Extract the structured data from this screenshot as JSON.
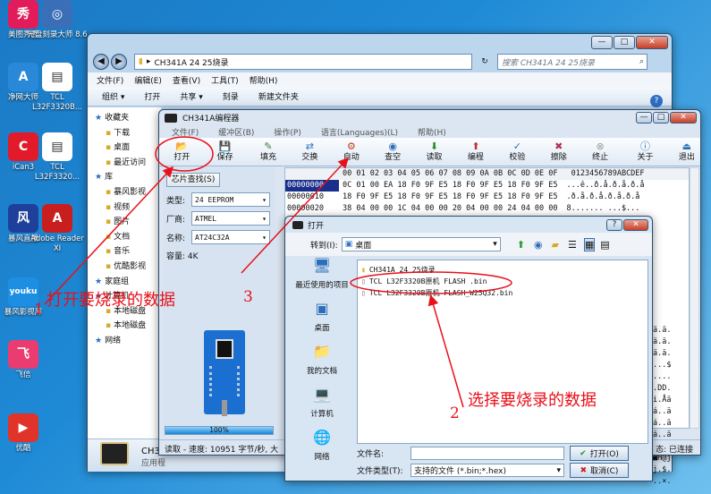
{
  "desktop": {
    "icons": [
      {
        "label": "美图秀秀",
        "icon": "meitu-icon",
        "color": "#e21c5a",
        "glyph": "秀"
      },
      {
        "label": "光盘刻录大师 8.6",
        "icon": "cd-burner-icon",
        "color": "#3a6fb8",
        "glyph": "◎"
      },
      {
        "label": "净网大师",
        "icon": "shield-a-icon",
        "color": "#2a88d8",
        "glyph": "A"
      },
      {
        "label": "TCL L32F3320B...",
        "icon": "document-icon",
        "color": "#ffffff",
        "glyph": "▤"
      },
      {
        "label": "iCan3",
        "icon": "ican-icon",
        "color": "#e11b2a",
        "glyph": "C"
      },
      {
        "label": "TCL L32F3320...",
        "icon": "document-icon",
        "color": "#ffffff",
        "glyph": "▤"
      },
      {
        "label": "暴风直播",
        "icon": "baofeng-icon",
        "color": "#1e3f9a",
        "glyph": "风"
      },
      {
        "label": "Adobe Reader XI",
        "icon": "adobe-reader-icon",
        "color": "#c81e1e",
        "glyph": "A"
      },
      {
        "label": "暴风影视库",
        "icon": "youku-icon",
        "color": "#1d8fe3",
        "glyph": "youku"
      },
      {
        "label": "飞信",
        "icon": "fetion-icon",
        "color": "#ea3c70",
        "glyph": "飞"
      },
      {
        "label": "优酷",
        "icon": "youku-play-icon",
        "color": "#e0342a",
        "glyph": "▶"
      }
    ]
  },
  "explorer": {
    "path": "CH341A 24 25烧录",
    "search_placeholder": "搜索 CH341A 24 25烧录",
    "menu": [
      "文件(F)",
      "编辑(E)",
      "查看(V)",
      "工具(T)",
      "帮助(H)"
    ],
    "toolbar": [
      "组织 ▾",
      "打开",
      "共享 ▾",
      "刻录",
      "新建文件夹"
    ],
    "nav": [
      "收藏夹",
      "下载",
      "桌面",
      "最近访问",
      "库",
      "暴风影视",
      "视频",
      "图片",
      "文档",
      "音乐",
      "优酷影视",
      "家庭组",
      "计算机",
      "本地磁盘",
      "本地磁盘",
      "网络"
    ],
    "footer": {
      "name": "CH3",
      "type": "应用程"
    }
  },
  "programmer": {
    "title": "CH341A编程器",
    "menu": [
      "文件(F)",
      "缓冲区(B)",
      "操作(P)",
      "语言(Languages)(L)",
      "帮助(H)"
    ],
    "tools": [
      {
        "label": "打开",
        "icon": "open-folder-icon"
      },
      {
        "label": "保存",
        "icon": "save-icon"
      },
      {
        "label": "填充",
        "icon": "fill-icon"
      },
      {
        "label": "交换",
        "icon": "swap-icon"
      },
      {
        "label": "自动",
        "icon": "auto-icon"
      },
      {
        "label": "查空",
        "icon": "check-blank-icon"
      },
      {
        "label": "读取",
        "icon": "read-icon"
      },
      {
        "label": "编程",
        "icon": "program-icon"
      },
      {
        "label": "校验",
        "icon": "verify-icon"
      },
      {
        "label": "擦除",
        "icon": "erase-icon"
      },
      {
        "label": "终止",
        "icon": "stop-icon"
      },
      {
        "label": "关于",
        "icon": "about-icon"
      },
      {
        "label": "退出",
        "icon": "exit-icon"
      }
    ],
    "chip_search": "芯片查找(S)",
    "type_label": "类型:",
    "type_value": "24 EEPROM",
    "maker_label": "厂商:",
    "maker_value": "ATMEL",
    "name_label": "名称:",
    "name_value": "AT24C32A",
    "capacity": "容量: 4K",
    "progress_text": "100%",
    "progress": 1.0,
    "status_read": "读取 - 速度: 10951 字节/秒, 大",
    "status_connected": "态: 已连接",
    "hex_header": "00 01 02 03 04 05 06 07 08 09 0A 0B 0C 0D 0E 0F",
    "ascii_header": "0123456789ABCDEF",
    "hex_rows": [
      {
        "addr": "00000000",
        "bytes": "0C 01 00 EA 18 F0 9F E5 18 F0 9F E5 18 F0 9F E5",
        "ascii": "...ê..ð.å.ð.å.ð.å"
      },
      {
        "addr": "00000010",
        "bytes": "18 F0 9F E5 18 F0 9F E5 18 F0 9F E5 18 F0 9F E5",
        "ascii": ".ð.å.ð.å.ð.å.ð.å"
      },
      {
        "addr": "00000020",
        "bytes": "38 04 00 00 1C 04 00 00 20 04 00 00 24 04 00 00",
        "ascii": "8....... ...$..."
      },
      {
        "addr": "00000030",
        "bytes": "28 04 00 00 2C 04 00 00 30 04 00 00 34 04 00 00",
        "ascii": "(...,...0...4..."
      }
    ],
    "right_ascii": [
      "ä.ä.",
      "ä.ä.",
      "ä.ä.",
      "...$",
      "....",
      ".DD.",
      "i.Åä",
      "á..ä",
      "á..ä",
      "á..ä",
      "á..ä",
      "■H@j",
      "j.$.",
      "..×."
    ]
  },
  "open_dialog": {
    "title": "打开",
    "lookin_label": "转到(I):",
    "lookin_value": "桌面",
    "places": [
      {
        "label": "最近使用的项目",
        "icon": "recent-icon"
      },
      {
        "label": "桌面",
        "icon": "desktop-icon"
      },
      {
        "label": "我的文档",
        "icon": "my-docs-icon"
      },
      {
        "label": "计算机",
        "icon": "computer-icon"
      },
      {
        "label": "网络",
        "icon": "network-icon"
      }
    ],
    "files": [
      {
        "name": "CH341A 24 25烧录",
        "icon": "folder-icon"
      },
      {
        "name": "TCL L32F3320B原机 FLASH .bin",
        "icon": "file-icon"
      },
      {
        "name": "TCL L32F3320B原机 FLASH_W25Q32.bin",
        "icon": "file-icon"
      }
    ],
    "filename_label": "文件名:",
    "filename_value": "",
    "filetype_label": "文件类型(T):",
    "filetype_value": "支持的文件 (*.bin;*.hex)",
    "open_button": "打开(O)",
    "cancel_button": "取消(C)"
  },
  "annotations": {
    "note1": "打开要烧录的数据",
    "num1": "1",
    "note2": "选择要烧录的数据",
    "num2": "2",
    "num3": "3",
    "color": "#e8101a"
  }
}
